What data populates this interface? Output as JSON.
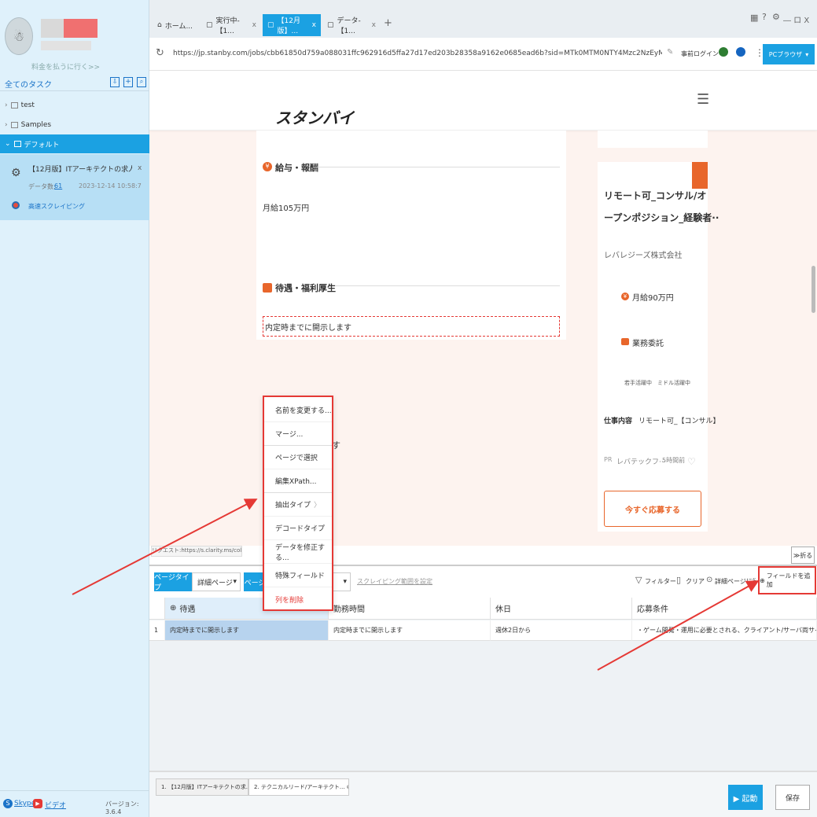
{
  "sidebar": {
    "pay_link": "料金を払うに行く>>",
    "all_tasks": "全てのタスク",
    "folders": [
      {
        "label": "test"
      },
      {
        "label": "Samples"
      },
      {
        "label": "デフォルト"
      }
    ],
    "task": {
      "title": "【12月版】ITアーキテクトの求人・仕事・...",
      "close": "x",
      "data_label": "データ数:",
      "data_count": "61",
      "timestamp": "2023-12-14 10:58:7",
      "mode": "高速スクレイピング"
    },
    "footer": {
      "skype": "Skype",
      "video": "ビデオ",
      "version": "バージョン: 3.6.4"
    }
  },
  "browser": {
    "tabs": [
      {
        "label": "ホーム...",
        "close": ""
      },
      {
        "label": "実行中-【1...",
        "close": "x"
      },
      {
        "label": "【12月版】...",
        "close": "x"
      },
      {
        "label": "データ-【1...",
        "close": "x"
      }
    ],
    "new_tab": "+",
    "window_controls": "― ロ X",
    "url": "https://jp.stanby.com/jobs/cbb61850d759a088031ffc962916d5ffa27d17ed203b28358a9162e0685ead6b?sid=MTk0MTM0NTY4Mzc2NzEyMzk2OCxodHRwczovL...",
    "pre_login": "事前ログイン",
    "pc_browser": "PCブラウザ"
  },
  "page": {
    "logo": "スタンバイ",
    "section1_title": "給与・報酬",
    "salary": "月給105万円",
    "section2_title": "待遇・福利厚生",
    "benefit": "内定時までに開示します",
    "partial_text": "す",
    "card": {
      "title1": "リモート可_コンサル/オ",
      "title2": "ープンポジション_経験者··",
      "company": "レバレジーズ株式会社",
      "salary": "月給90万円",
      "type": "業務委託",
      "tags": "若手活躍中　ミドル活躍中",
      "desc_label": "仕事内容",
      "desc": "リモート可_【コンサル】",
      "pr": "PR",
      "pr_text": "レバテックフ···",
      "time": "5時間前",
      "apply": "今すぐ応募する"
    }
  },
  "context_menu": {
    "items": [
      "名前を変更する...",
      "マージ...",
      "ページで選択",
      "編集XPath...",
      "抽出タイプ",
      "デコードタイプ",
      "データを修正する...",
      "特殊フィールド",
      "列を削除"
    ]
  },
  "request_text": "リクエスト:https://s.clarity.ms/collect",
  "collapse": "≫折る",
  "toolbar": {
    "page_type": "ページタイプ",
    "detail_page": "詳細ページ",
    "page_partial": "ページ",
    "scrape_range": "スクレイピング範囲を設定",
    "filter": "フィルター",
    "clear": "クリア",
    "detail_page_btn": "詳細ページに行",
    "add_field": "フィールドを追加"
  },
  "table": {
    "headers": [
      "待遇",
      "勤務時間",
      "休日",
      "応募条件"
    ],
    "rows": [
      {
        "num": "1",
        "cells": [
          "内定時までに開示します",
          "内定時までに開示します",
          "週休2日から",
          "・ゲーム開発・運用に必要とされる、クライアント/サーバ両サイド..."
        ]
      }
    ]
  },
  "bottom_tabs": [
    "1. 【12月版】ITアーキテクトの求...",
    "2. テクニカルリード/アーキテクト..."
  ],
  "buttons": {
    "start": "▶ 起動",
    "save": "保存"
  }
}
